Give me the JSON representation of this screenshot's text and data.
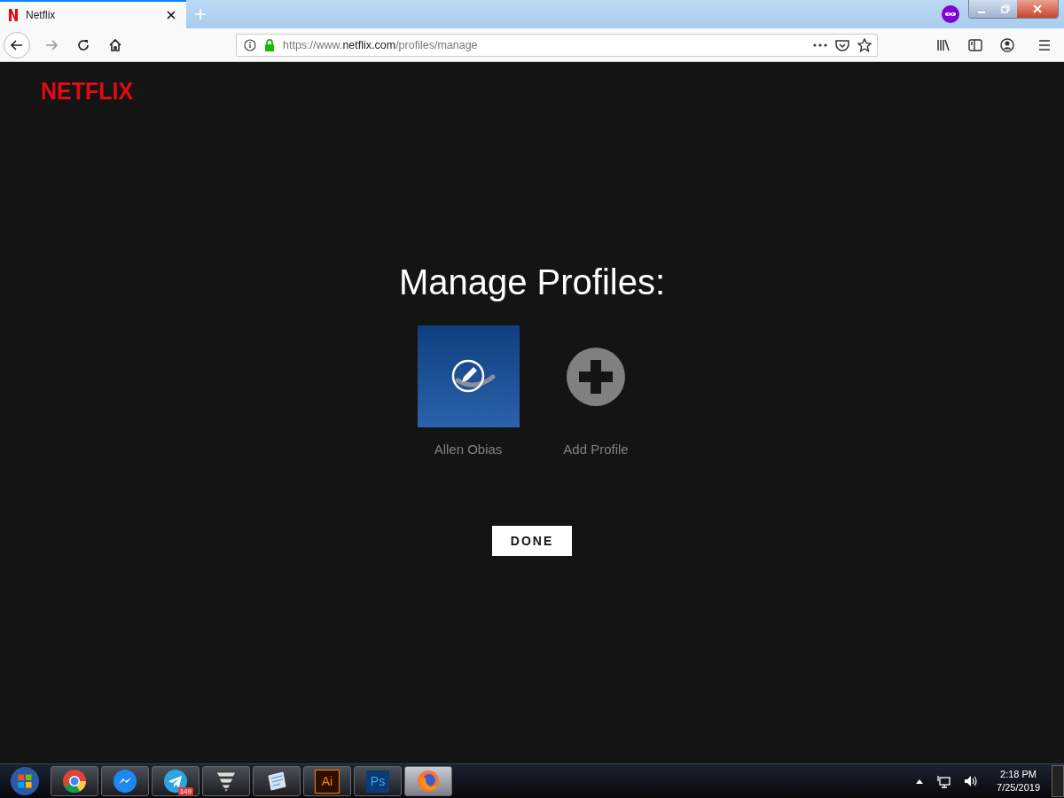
{
  "browser": {
    "tab": {
      "title": "Netflix",
      "selected": true
    },
    "url": {
      "scheme": "https://www.",
      "domain": "netflix.com",
      "path": "/profiles/manage"
    }
  },
  "page": {
    "logo": "NETFLIX",
    "heading": "Manage Profiles:",
    "profiles": [
      {
        "kind": "profile",
        "name": "Allen Obias"
      },
      {
        "kind": "add",
        "name": "Add Profile"
      }
    ],
    "done": "DONE"
  },
  "taskbar": {
    "apps": [
      {
        "kind": "chrome",
        "selected": false
      },
      {
        "kind": "messenger",
        "selected": false
      },
      {
        "kind": "telegram",
        "badge": "149",
        "selected": false
      },
      {
        "kind": "vpn",
        "selected": false
      },
      {
        "kind": "notes",
        "selected": false
      },
      {
        "kind": "illustrator",
        "label": "Ai",
        "selected": false
      },
      {
        "kind": "photoshop",
        "label": "Ps",
        "selected": false
      },
      {
        "kind": "firefox",
        "selected": true
      }
    ],
    "clock": {
      "time": "2:18 PM",
      "date": "7/25/2019"
    }
  }
}
